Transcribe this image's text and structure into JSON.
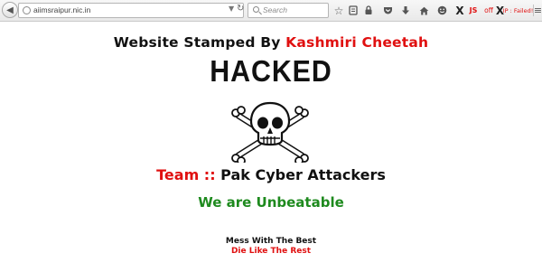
{
  "browser": {
    "url": "aiimsraipur.nic.in",
    "search_placeholder": "Search",
    "toolbar_icons": [
      "star-icon",
      "bookmarks-icon",
      "lock-icon",
      "pocket-icon",
      "download-icon",
      "home-icon",
      "emoji-icon"
    ],
    "addons": {
      "js_label": "JS",
      "x1_label": "X",
      "off_label": "off",
      "x2_label": "X",
      "ip_label": "IP : Failed!",
      "menu_label": "≡"
    }
  },
  "page": {
    "stamp_prefix": "Website Stamped By ",
    "stamp_name": "Kashmiri Cheetah",
    "hacked": "HACKED",
    "team_prefix": "Team :: ",
    "team_name": "Pak Cyber Attackers",
    "unbeatable": "We are Unbeatable",
    "mess": "Mess With The Best",
    "die": "Die Like The Rest"
  },
  "colors": {
    "red": "#e01010",
    "green": "#1e8a1e",
    "black": "#111111"
  }
}
